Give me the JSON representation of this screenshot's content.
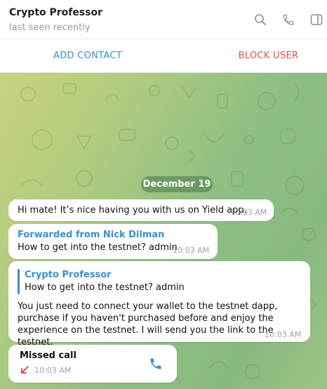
{
  "header": {
    "title": "Crypto Professor",
    "status": "last seen recently"
  },
  "actions": {
    "add_contact": "ADD CONTACT",
    "block_user": "BLOCK USER"
  },
  "chat": {
    "date_badge": "December 19",
    "messages": [
      {
        "text": "Hi mate! It’s nice having you with us on Yield app.",
        "time": "10:03 AM"
      },
      {
        "forwarded_from": "Forwarded from Nick Dilman",
        "text": "How to get into the testnet? admin",
        "time": "10:03 AM"
      },
      {
        "reply_name": "Crypto Professor",
        "reply_text": "How to get into the testnet? admin",
        "text": "You just need to connect your wallet to the testnet dapp, purchase if you haven't purchased before and enjoy the experience on the testnet. I will send you the link to the testnet.",
        "time": "10:03 AM"
      },
      {
        "title": "Missed call",
        "time": "10:03 AM"
      }
    ]
  },
  "colors": {
    "accent": "#3a90c9",
    "danger": "#d9534f",
    "missed": "#e53935",
    "date_badge_bg": "#4b7a4b"
  },
  "icons": [
    "search-icon",
    "phone-icon",
    "sidebar-toggle-icon",
    "missed-call-arrow-icon",
    "call-back-icon"
  ]
}
